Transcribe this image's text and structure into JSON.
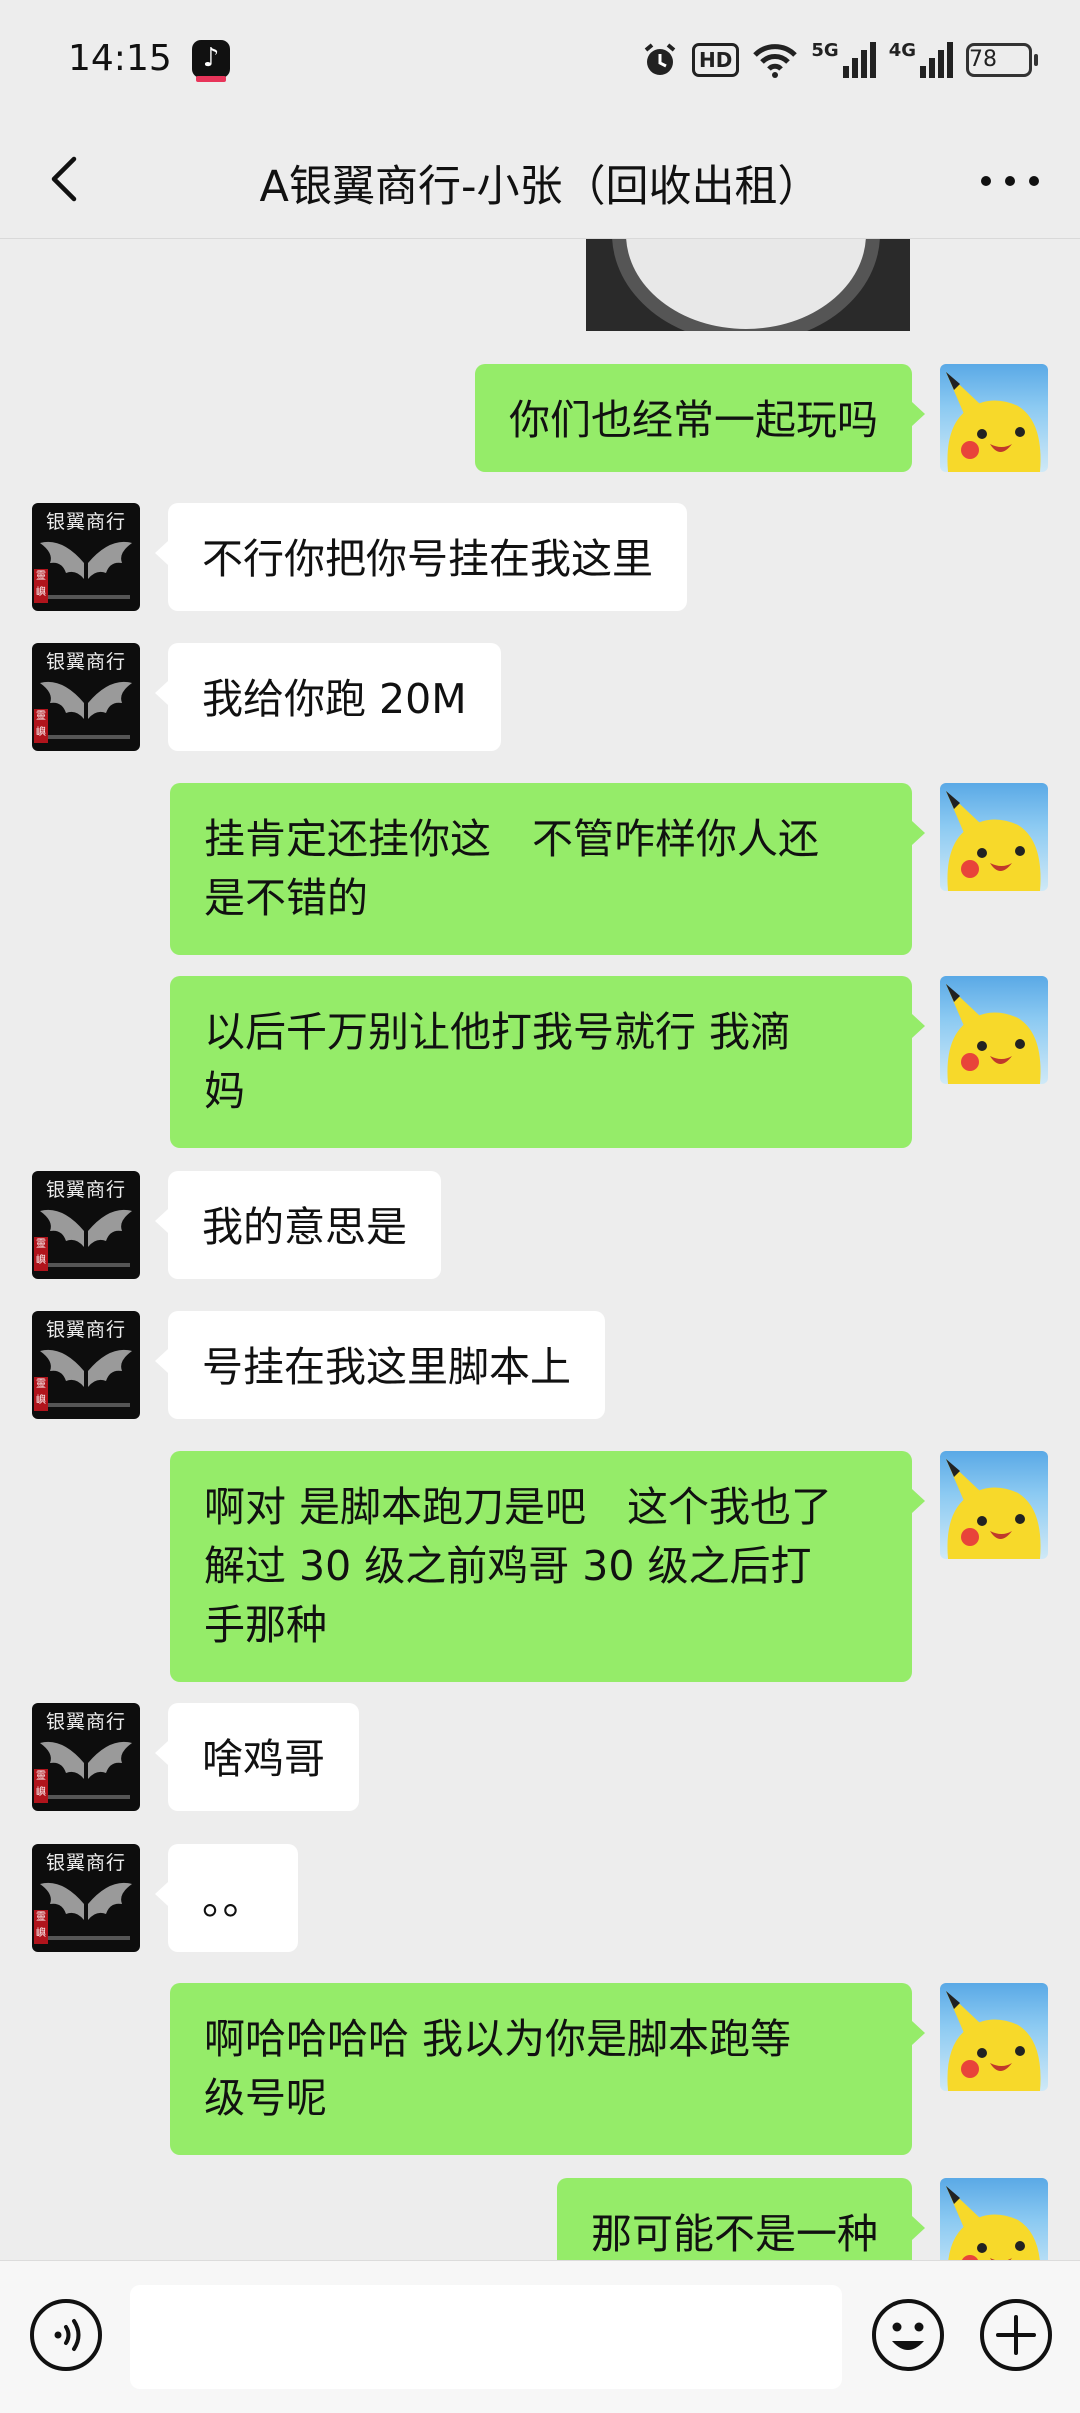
{
  "status_bar": {
    "time": "14:15",
    "app_icon": "tiktok-icon",
    "hd_label": "HD",
    "net_5g": "5G",
    "net_4g": "4G",
    "battery": "78"
  },
  "header": {
    "title": "A银翼商行-小张（回收出租）"
  },
  "contact_avatar": {
    "label": "银翼商行",
    "seal": "靈嶼"
  },
  "messages": [
    {
      "side": "right",
      "text": "你们也经常一起玩吗"
    },
    {
      "side": "left",
      "text": "不行你把你号挂在我这里"
    },
    {
      "side": "left",
      "text": "我给你跑 20M"
    },
    {
      "side": "right",
      "lines": [
        "挂肯定还挂你这　不管咋样你人还",
        "是不错的"
      ]
    },
    {
      "side": "right",
      "lines": [
        "以后千万别让他打我号就行  我滴",
        "妈"
      ]
    },
    {
      "side": "left",
      "text": "我的意思是"
    },
    {
      "side": "left",
      "text": "号挂在我这里脚本上"
    },
    {
      "side": "right",
      "lines": [
        "啊对 是脚本跑刀是吧　这个我也了",
        "解过  30 级之前鸡哥  30 级之后打",
        "手那种"
      ]
    },
    {
      "side": "left",
      "text": "啥鸡哥"
    },
    {
      "side": "left",
      "text": "。。"
    },
    {
      "side": "right",
      "lines": [
        "啊哈哈哈哈  我以为你是脚本跑等",
        "级号呢"
      ]
    },
    {
      "side": "right",
      "text": "那可能不是一种"
    }
  ],
  "input_bar": {
    "value": ""
  },
  "colors": {
    "background": "#ededed",
    "bubble_sent": "#95ec69",
    "bubble_received": "#ffffff"
  }
}
